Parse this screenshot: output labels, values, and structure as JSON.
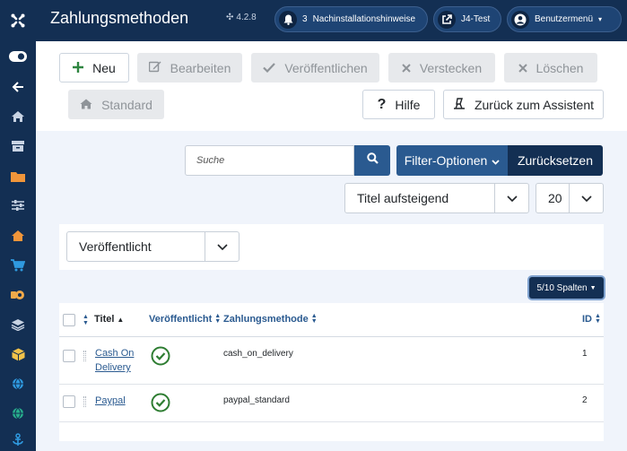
{
  "header": {
    "title": "Zahlungsmethoden",
    "version": "4.2.8",
    "notifications_count": "3",
    "notifications_label": "Nachinstallationshinweise",
    "site_label": "J4-Test",
    "user_label": "Benutzermenü"
  },
  "toolbar": {
    "new_label": "Neu",
    "edit_label": "Bearbeiten",
    "publish_label": "Veröffentlichen",
    "unpublish_label": "Verstecken",
    "delete_label": "Löschen",
    "default_label": "Standard",
    "help_label": "Hilfe",
    "back_label": "Zurück zum Assistent"
  },
  "search": {
    "placeholder": "Suche",
    "filter_options_label": "Filter-Optionen",
    "reset_label": "Zurücksetzen"
  },
  "list": {
    "ordering_value": "Titel aufsteigend",
    "limit_value": "20",
    "status_filter_value": "Veröffentlicht",
    "columns_label": "5/10 Spalten"
  },
  "table": {
    "headers": {
      "title": "Titel",
      "published": "Veröffentlicht",
      "method": "Zahlungsmethode",
      "id": "ID"
    },
    "rows": [
      {
        "title_line1": "Cash On",
        "title_line2": "Delivery",
        "method": "cash_on_delivery",
        "id": "1",
        "published": "yes"
      },
      {
        "title_line1": "Paypal",
        "title_line2": "",
        "method": "paypal_standard",
        "id": "2",
        "published": "yes"
      }
    ]
  },
  "colors": {
    "header_bg": "#132f53",
    "primary": "#2a5a90",
    "success": "#2e7d32",
    "new_icon": "#2e8540"
  },
  "sidebar_icons": [
    "toggle-icon",
    "back-arrow-icon",
    "home-icon",
    "archive-icon",
    "folder-icon",
    "sliders-icon",
    "store-icon",
    "cart-icon",
    "pay-icon",
    "layers-icon",
    "box-icon",
    "globe-icon",
    "globe-icon",
    "anchor-icon"
  ]
}
